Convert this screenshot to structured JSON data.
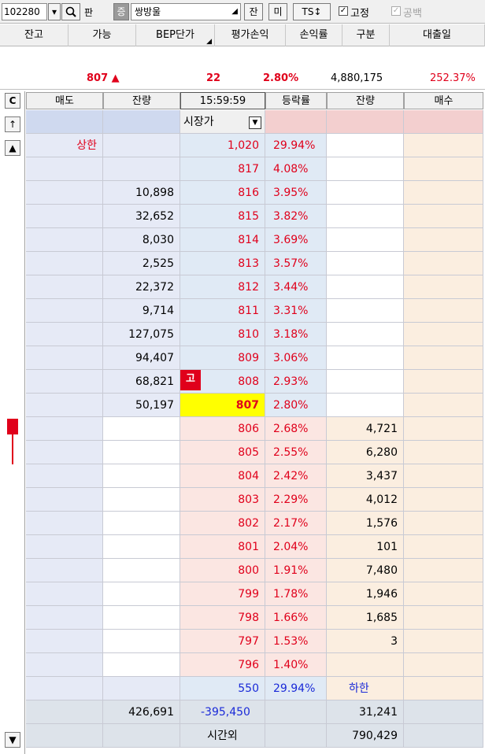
{
  "topbar": {
    "code": "102280",
    "pan": "판",
    "jeung": "증",
    "name": "쌍방울",
    "jan": "잔",
    "mi": "미",
    "ts": "TS↕",
    "fixed_label": "고정",
    "gongbaek_label": "공백"
  },
  "header": [
    "잔고",
    "가능",
    "BEP단가",
    "평가손익",
    "손익률",
    "구분",
    "대출일"
  ],
  "summary": {
    "price": "807 ▲",
    "change": "22",
    "rate": "2.80%",
    "volume": "4,880,175",
    "pct": "252.37%"
  },
  "side_buttons": {
    "c": "C",
    "up_arrow": "↑",
    "up": "▲",
    "down": "▼"
  },
  "columns": [
    "매도",
    "잔량",
    "15:59:59",
    "등락률",
    "잔량",
    "매수"
  ],
  "market_price_label": "시장가",
  "sell_rows": [
    {
      "label": "상한",
      "qty": "",
      "price": "1,020",
      "rate": "29.94%"
    },
    {
      "label": "",
      "qty": "",
      "price": "817",
      "rate": "4.08%"
    },
    {
      "label": "",
      "qty": "10,898",
      "price": "816",
      "rate": "3.95%"
    },
    {
      "label": "",
      "qty": "32,652",
      "price": "815",
      "rate": "3.82%"
    },
    {
      "label": "",
      "qty": "8,030",
      "price": "814",
      "rate": "3.69%"
    },
    {
      "label": "",
      "qty": "2,525",
      "price": "813",
      "rate": "3.57%"
    },
    {
      "label": "",
      "qty": "22,372",
      "price": "812",
      "rate": "3.44%"
    },
    {
      "label": "",
      "qty": "9,714",
      "price": "811",
      "rate": "3.31%"
    },
    {
      "label": "",
      "qty": "127,075",
      "price": "810",
      "rate": "3.18%"
    },
    {
      "label": "",
      "qty": "94,407",
      "price": "809",
      "rate": "3.06%"
    },
    {
      "label": "",
      "qty": "68,821",
      "price": "808",
      "rate": "2.93%",
      "badge": "고"
    },
    {
      "label": "",
      "qty": "50,197",
      "price": "807",
      "rate": "2.80%",
      "current": true
    }
  ],
  "buy_rows": [
    {
      "price": "806",
      "rate": "2.68%",
      "qty": "4,721"
    },
    {
      "price": "805",
      "rate": "2.55%",
      "qty": "6,280"
    },
    {
      "price": "804",
      "rate": "2.42%",
      "qty": "3,437"
    },
    {
      "price": "803",
      "rate": "2.29%",
      "qty": "4,012"
    },
    {
      "price": "802",
      "rate": "2.17%",
      "qty": "1,576"
    },
    {
      "price": "801",
      "rate": "2.04%",
      "qty": "101"
    },
    {
      "price": "800",
      "rate": "1.91%",
      "qty": "7,480"
    },
    {
      "price": "799",
      "rate": "1.78%",
      "qty": "1,946"
    },
    {
      "price": "798",
      "rate": "1.66%",
      "qty": "1,685"
    },
    {
      "price": "797",
      "rate": "1.53%",
      "qty": "3"
    },
    {
      "price": "796",
      "rate": "1.40%",
      "qty": ""
    },
    {
      "price": "550",
      "rate": "29.94%",
      "qty": "",
      "label": "하한",
      "lower": true
    }
  ],
  "totals": {
    "sell_total": "426,691",
    "diff": "-395,450",
    "buy_total": "31,241"
  },
  "after_hours": {
    "label": "시간외",
    "qty": "790,429"
  },
  "colors": {
    "red": "#e0001b",
    "blue": "#1a2ad8",
    "yellow": "#ffff00"
  }
}
